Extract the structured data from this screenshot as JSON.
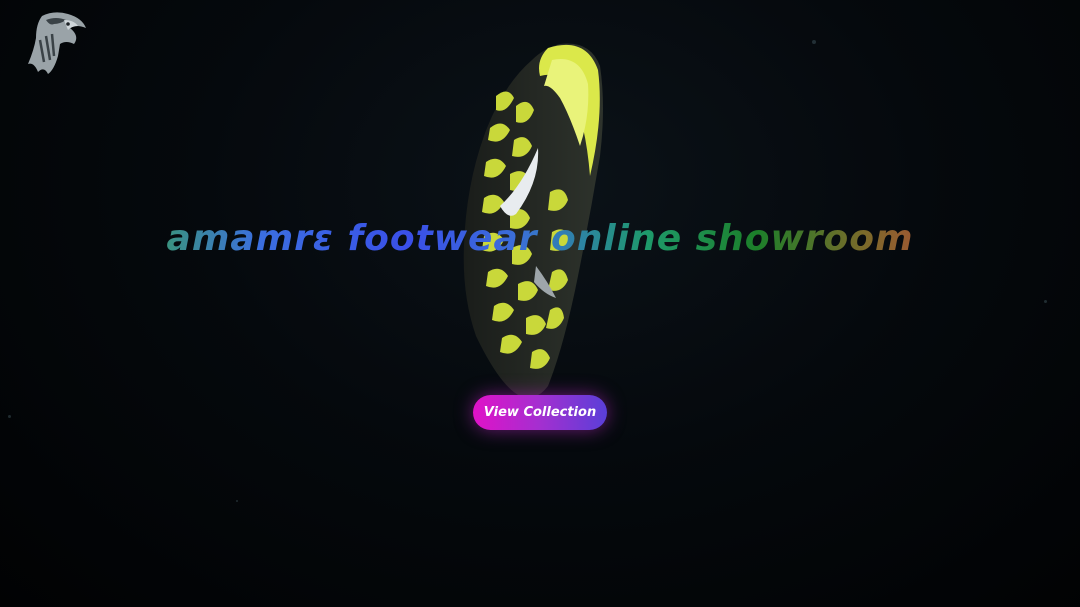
{
  "header": {
    "logo_icon": "ram-head-logo-icon"
  },
  "hero": {
    "headline": "amamrε footwear online showroom",
    "image_icon": "running-shoe-image",
    "cta_label": "View Collection"
  },
  "colors": {
    "background": "#05090d",
    "headline_gradient": [
      "#21d93a",
      "#3a4fe8",
      "#1c7f2a",
      "#e23b3b"
    ],
    "button_gradient": [
      "#e012c8",
      "#5a3fd8"
    ],
    "button_text": "#ffffff"
  }
}
